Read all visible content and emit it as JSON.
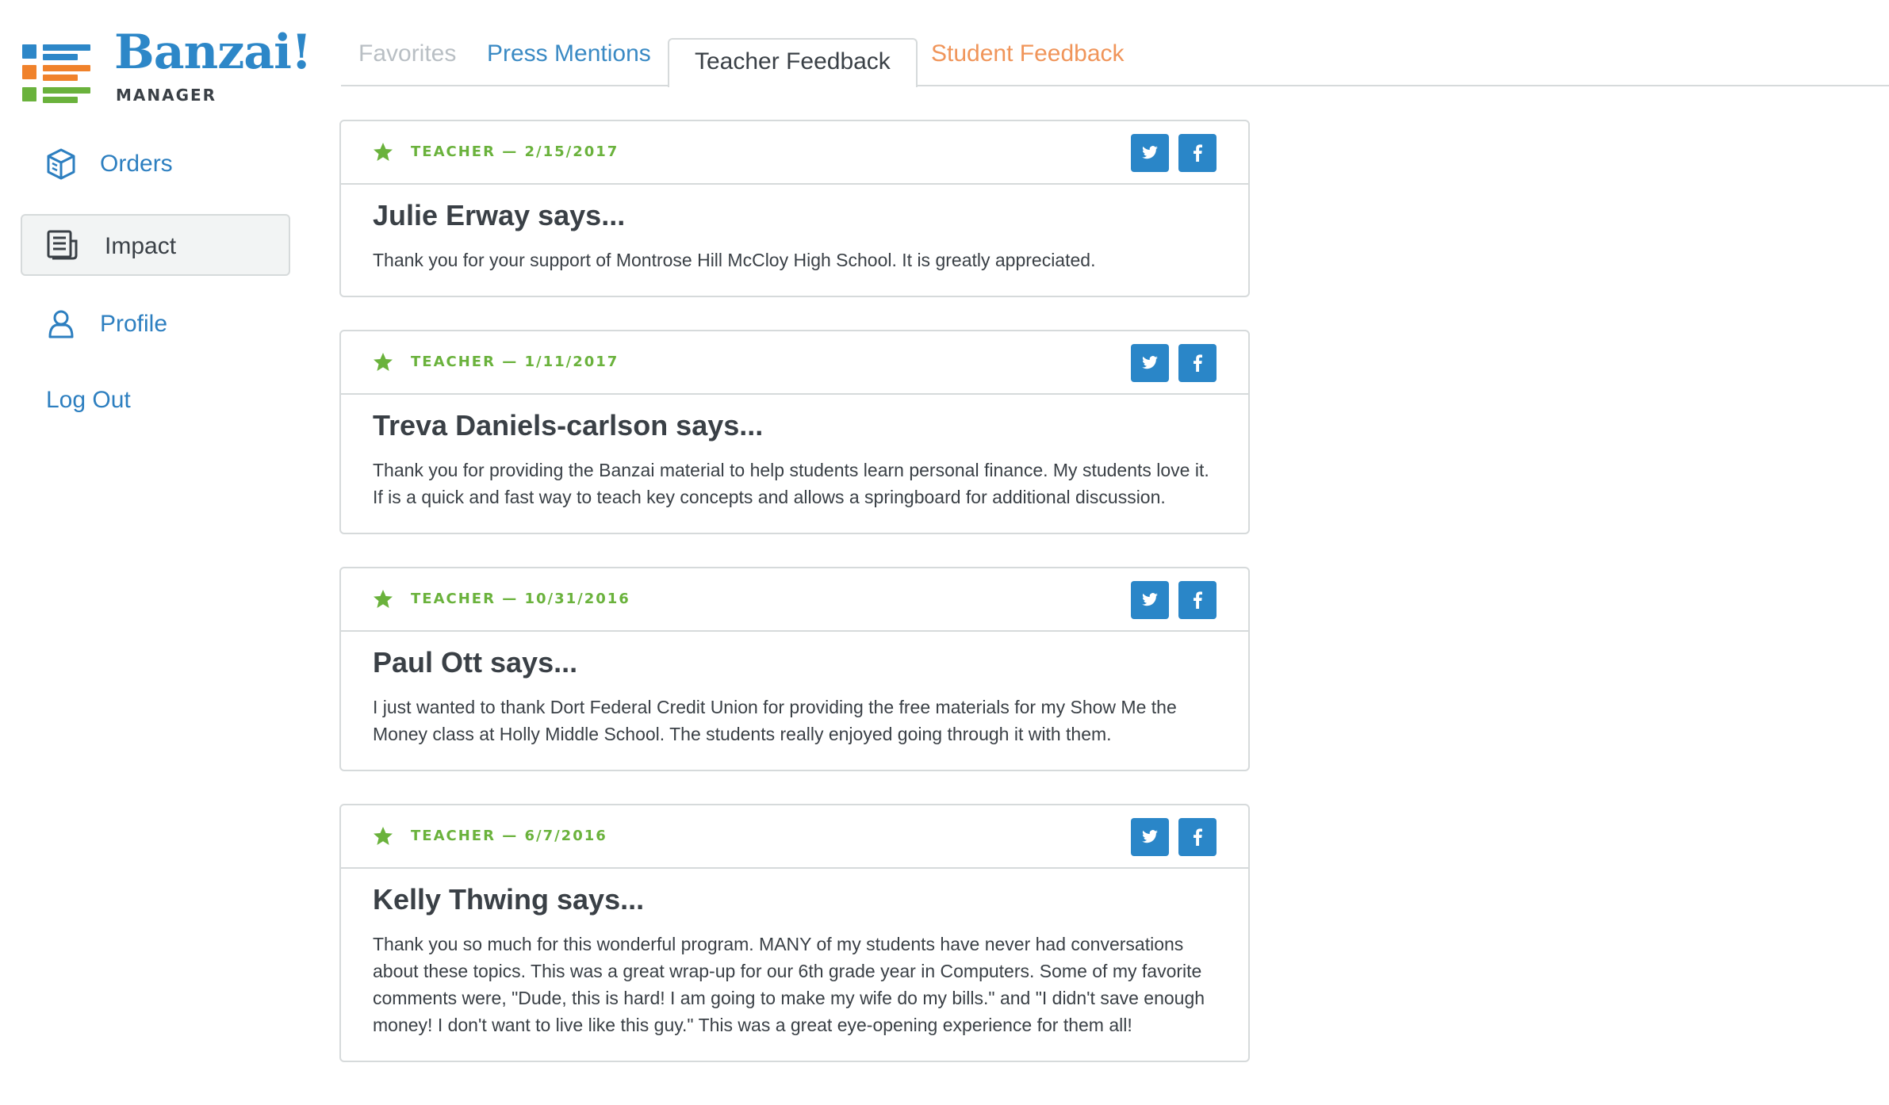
{
  "brand": {
    "name": "Banzai!",
    "subtitle": "MANAGER",
    "mark_colors": {
      "blue": "#2d87c8",
      "orange": "#f0822b",
      "green": "#6ab23c"
    }
  },
  "sidebar": {
    "items": [
      {
        "label": "Orders",
        "icon": "box-icon",
        "active": false
      },
      {
        "label": "Impact",
        "icon": "report-icon",
        "active": true
      },
      {
        "label": "Profile",
        "icon": "person-icon",
        "active": false
      }
    ],
    "logout_label": "Log Out"
  },
  "tabs": [
    {
      "label": "Favorites",
      "color": "#b9bfc4",
      "active": false
    },
    {
      "label": "Press Mentions",
      "color": "#3a8ac4",
      "active": false
    },
    {
      "label": "Teacher Feedback",
      "color": "#3a4046",
      "active": true
    },
    {
      "label": "Student Feedback",
      "color": "#f0955a",
      "active": false
    }
  ],
  "feedback": [
    {
      "meta": "TEACHER — 2/15/2017",
      "author": "Julie Erway says...",
      "message": "Thank you for your support of Montrose Hill McCloy High School. It is greatly appreciated."
    },
    {
      "meta": "TEACHER — 1/11/2017",
      "author": "Treva Daniels-carlson says...",
      "message": "Thank you for providing the Banzai material to help students learn personal finance. My students love it. If is a quick and fast way to teach key concepts and allows a springboard for additional discussion."
    },
    {
      "meta": "TEACHER — 10/31/2016",
      "author": "Paul Ott says...",
      "message": "I just wanted to thank Dort Federal Credit Union for providing the free materials for my Show Me the Money class at Holly Middle School. The students really enjoyed going through it with them."
    },
    {
      "meta": "TEACHER — 6/7/2016",
      "author": "Kelly Thwing says...",
      "message": "Thank you so much for this wonderful program. MANY of my students have never had conversations about these topics. This was a great wrap-up for our 6th grade year in Computers. Some of my favorite comments were, \"Dude, this is hard! I am going to make my wife do my bills.\" and \"I didn't save enough money! I don't want to live like this guy.\" This was a great eye-opening experience for them all!"
    }
  ],
  "icons": {
    "favorite": "star-icon",
    "twitter": "twitter-icon",
    "facebook": "facebook-icon"
  },
  "colors": {
    "accent_blue": "#2a86c8",
    "meta_green": "#6ab23c",
    "border": "#d6dadb"
  }
}
